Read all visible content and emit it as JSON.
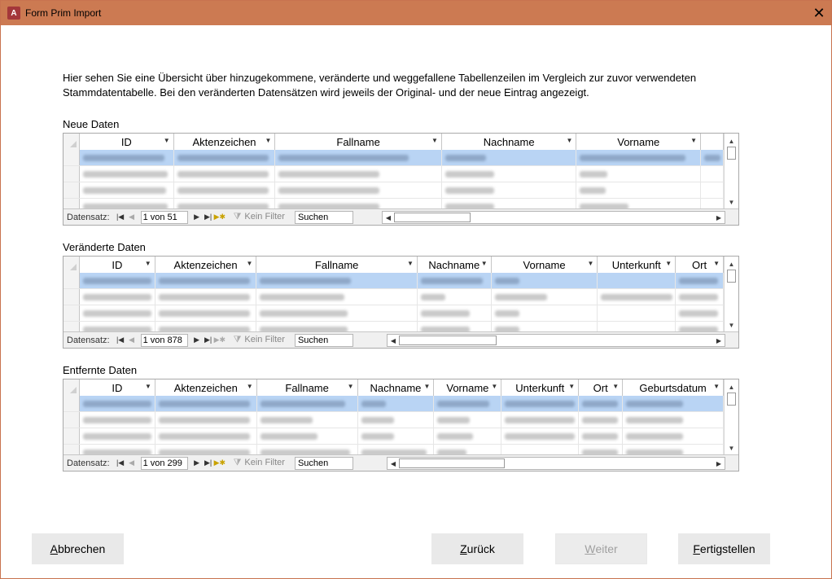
{
  "window": {
    "title": "Form Prim Import",
    "icon": "access-app-icon",
    "close_glyph": "✕"
  },
  "intro_text": "Hier sehen Sie eine Übersicht über hinzugekommene, veränderte und weggefallene Tabellenzeilen im Vergleich zur zuvor verwendeten Stammdatentabelle. Bei den veränderten Datensätzen wird jeweils der Original- und der neue Eintrag angezeigt.",
  "sections": [
    {
      "label": "Neue Daten",
      "columns": [
        "ID",
        "Aktenzeichen",
        "Fallname",
        "Nachname",
        "Vorname",
        ""
      ],
      "navigation": {
        "label": "Datensatz:",
        "position": "1 von 51",
        "filter": "Kein Filter",
        "search": "Suchen"
      }
    },
    {
      "label": "Veränderte Daten",
      "columns": [
        "ID",
        "Aktenzeichen",
        "Fallname",
        "Nachname",
        "Vorname",
        "Unterkunft",
        "Ort"
      ],
      "navigation": {
        "label": "Datensatz:",
        "position": "1 von 878",
        "filter": "Kein Filter",
        "search": "Suchen"
      }
    },
    {
      "label": "Entfernte Daten",
      "columns": [
        "ID",
        "Aktenzeichen",
        "Fallname",
        "Nachname",
        "Vorname",
        "Unterkunft",
        "Ort",
        "Geburtsdatum"
      ],
      "navigation": {
        "label": "Datensatz:",
        "position": "1 von 299",
        "filter": "Kein Filter",
        "search": "Suchen"
      }
    }
  ],
  "buttons": {
    "cancel": {
      "mnemonic": "A",
      "rest": "bbrechen"
    },
    "back": {
      "mnemonic": "Z",
      "rest": "urück"
    },
    "next": {
      "mnemonic": "W",
      "rest": "eiter"
    },
    "finish": {
      "mnemonic": "F",
      "rest": "ertigstellen"
    }
  }
}
